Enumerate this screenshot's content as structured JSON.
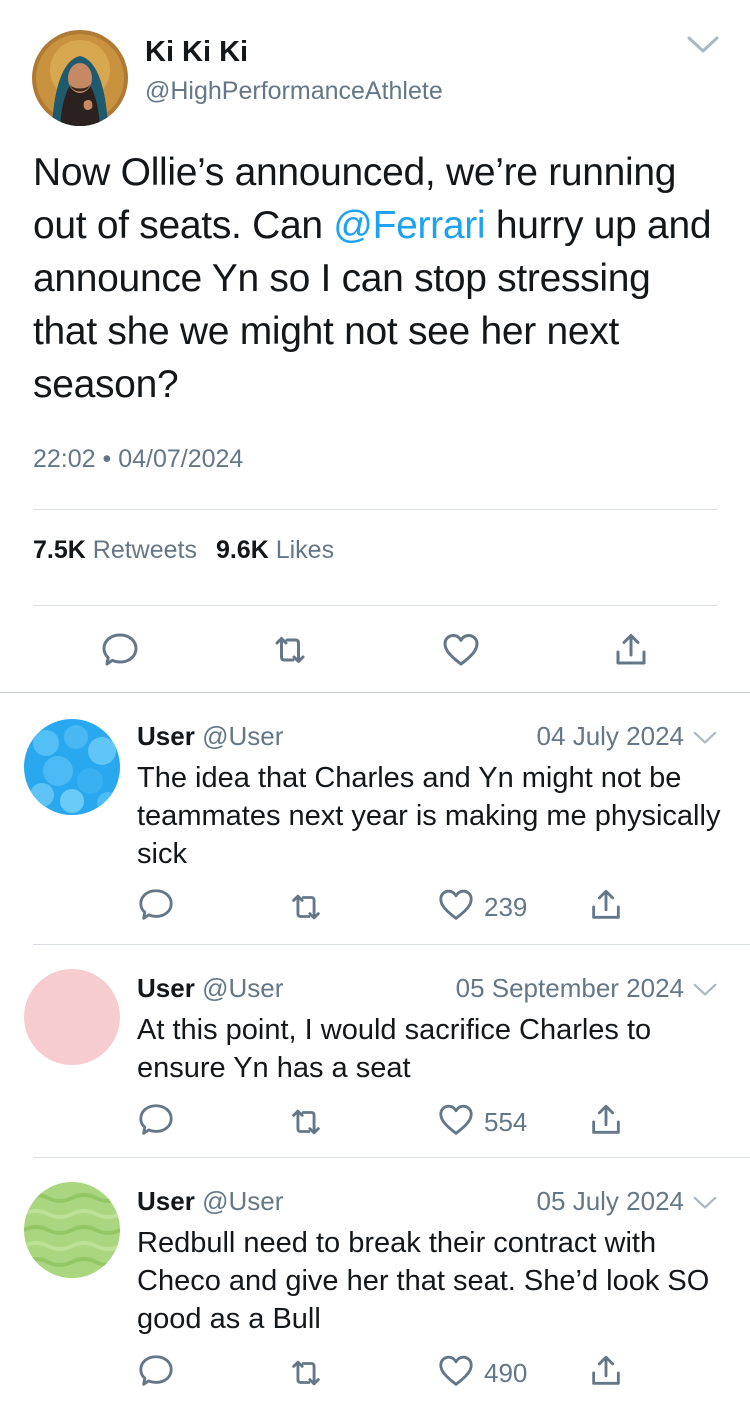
{
  "tweet": {
    "author_name": "Ki Ki Ki",
    "author_handle": "@HighPerformanceAthlete",
    "text_before": "Now Ollie’s announced, we’re running out of seats. Can ",
    "mention": "@Ferrari",
    "text_after": " hurry up and announce Yn so I can stop stressing that she we might not see her next season?",
    "timestamp": "22:02 • 04/07/2024",
    "retweets_count": "7.5K",
    "retweets_label": "Retweets",
    "likes_count": "9.6K",
    "likes_label": "Likes"
  },
  "replies": [
    {
      "name": "User",
      "handle": "@User",
      "date": "04 July 2024",
      "text": "The idea that Charles and Yn might not be teammates next year is making me physically sick",
      "likes": "239",
      "avatar_color": "#29a8f0"
    },
    {
      "name": "User",
      "handle": "@User",
      "date": "05 September 2024",
      "text": "At this point, I would sacrifice Charles to ensure Yn has a seat",
      "likes": "554",
      "avatar_color": "#f7ccd1"
    },
    {
      "name": "User",
      "handle": "@User",
      "date": "05 July 2024",
      "text": "Redbull need to break their contract with Checo and give her that seat. She’d look SO good as a Bull",
      "likes": "490",
      "avatar_color": "#a9d67e"
    }
  ],
  "icons": {
    "reply": "speech-bubble-icon",
    "retweet": "retweet-icon",
    "like": "heart-icon",
    "share": "share-icon",
    "menu": "chevron-down-icon"
  },
  "colors": {
    "link": "#1da1f2",
    "secondary_text": "#657786",
    "icon": "#657786"
  }
}
